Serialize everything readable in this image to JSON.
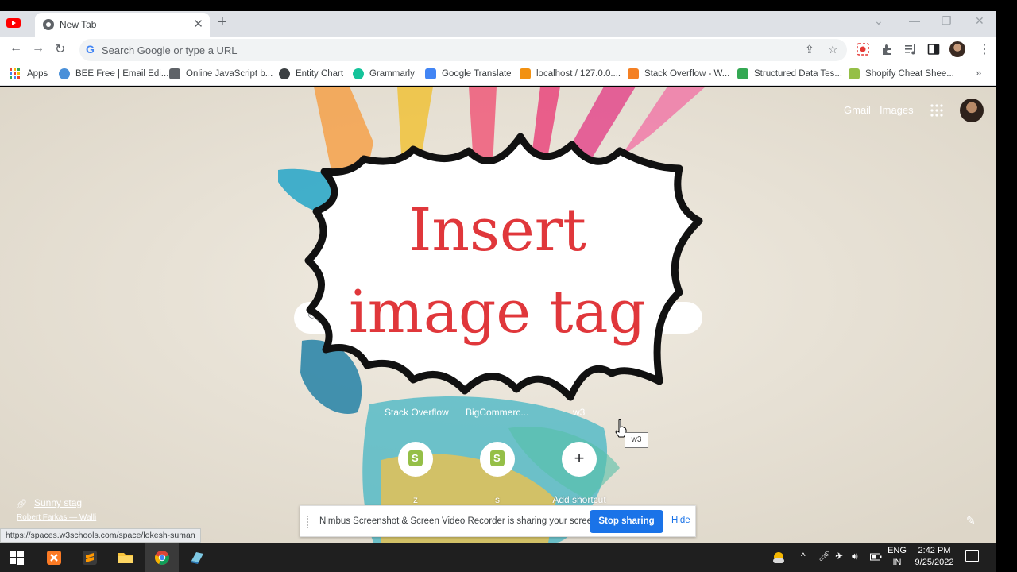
{
  "browser": {
    "tab": {
      "title": "New Tab"
    },
    "address_bar": {
      "placeholder": "Search Google or type a URL"
    },
    "bookmarks": [
      {
        "label": "Apps",
        "color": "#ea4335"
      },
      {
        "label": "BEE Free | Email Edi...",
        "color": "#4a90d9"
      },
      {
        "label": "Online JavaScript b...",
        "color": "#5f6368"
      },
      {
        "label": "Entity Chart",
        "color": "#3c4043"
      },
      {
        "label": "Grammarly",
        "color": "#15c39a"
      },
      {
        "label": "Google Translate",
        "color": "#4285f4"
      },
      {
        "label": "localhost / 127.0.0....",
        "color": "#f29111"
      },
      {
        "label": "Stack Overflow - W...",
        "color": "#f48024"
      },
      {
        "label": "Structured Data Tes...",
        "color": "#34a853"
      },
      {
        "label": "Shopify Cheat Shee...",
        "color": "#95bf47"
      }
    ]
  },
  "ntp": {
    "gmail_label": "Gmail",
    "images_label": "Images",
    "search_placeholder": "",
    "shortcuts_row1": [
      "Stack Overflow",
      "BigCommerc...",
      "w3"
    ],
    "shortcuts_row2": [
      {
        "label": "z",
        "icon": "shopify-icon"
      },
      {
        "label": "s",
        "icon": "shopify-icon"
      },
      {
        "label": "Add shortcut",
        "icon": "plus-icon"
      }
    ],
    "tooltip": "w3",
    "background_credit": {
      "title": "Sunny stag",
      "author": "Robert Farkas — Walli"
    }
  },
  "overlay": {
    "line1": "Insert",
    "line2": "image tag"
  },
  "status_url": "https://spaces.w3schools.com/space/lokesh-suman",
  "share_bar": {
    "message": "Nimbus Screenshot & Screen Video Recorder is sharing your screen.",
    "stop_label": "Stop sharing",
    "hide_label": "Hide"
  },
  "taskbar": {
    "lang_line1": "ENG",
    "lang_line2": "IN",
    "time": "2:42 PM",
    "date": "9/25/2022"
  }
}
